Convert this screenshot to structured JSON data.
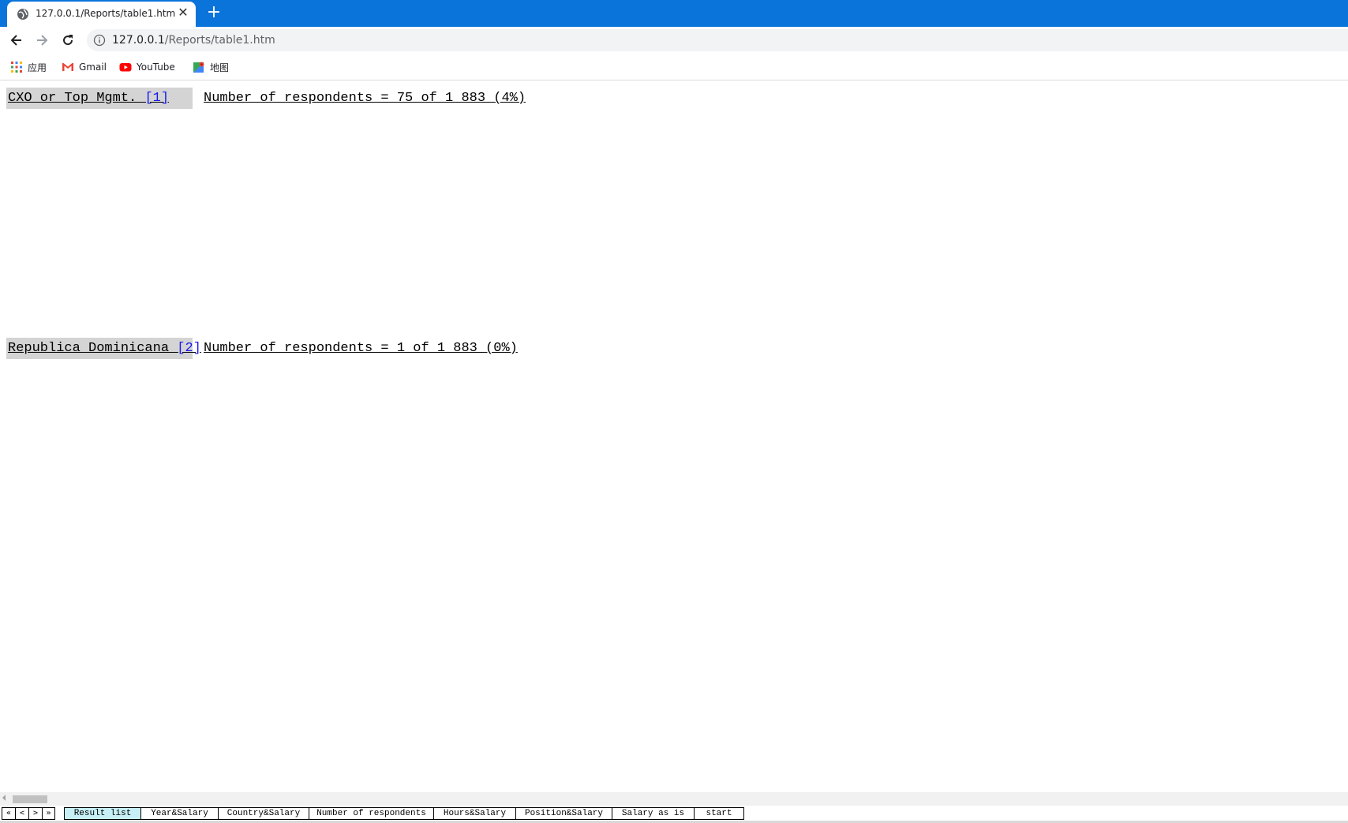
{
  "browser": {
    "tab_title": "127.0.0.1/Reports/table1.htm",
    "close_glyph": "✕",
    "newtab_glyph": "+",
    "url_host": "127.0.0.1",
    "url_path": "/Reports/table1.htm",
    "bookmarks": [
      {
        "label": "应用",
        "icon": "apps-grid-icon"
      },
      {
        "label": "Gmail",
        "icon": "gmail-icon"
      },
      {
        "label": "YouTube",
        "icon": "youtube-icon"
      },
      {
        "label": "地图",
        "icon": "maps-icon"
      }
    ]
  },
  "report": {
    "rows": [
      {
        "label": "CXO or Top Mgmt. ",
        "ref": "[1]",
        "count": "Number of respondents = 75 of 1 883 (4%)"
      },
      {
        "label": "Republica Dominicana ",
        "ref": "[2]",
        "count": "Number of respondents = 1 of 1 883 (0%)"
      }
    ]
  },
  "sheets": {
    "nav": [
      "«",
      "<",
      ">",
      "»"
    ],
    "tabs": [
      {
        "label": "Result list",
        "active": true
      },
      {
        "label": "Year&Salary",
        "active": false
      },
      {
        "label": "Country&Salary",
        "active": false
      },
      {
        "label": "Number of respondents",
        "active": false
      },
      {
        "label": "Hours&Salary",
        "active": false
      },
      {
        "label": "Position&Salary",
        "active": false
      },
      {
        "label": "Salary as is",
        "active": false
      },
      {
        "label": "start",
        "active": false
      }
    ]
  }
}
